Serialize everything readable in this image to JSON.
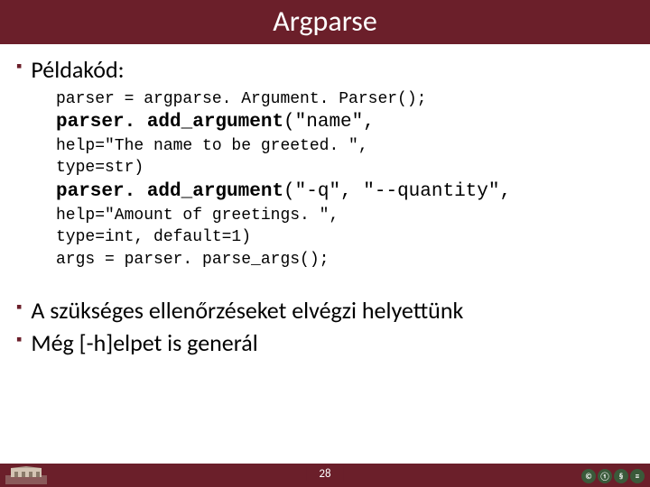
{
  "title": "Argparse",
  "bullets": {
    "example_label": "Példakód:",
    "summary1": "A szükséges ellenőrzéseket elvégzi helyettünk",
    "summary2": "Még [-h]elpet is generál"
  },
  "code": {
    "l1": "parser = argparse. Argument. Parser();",
    "l2a": "parser. add_argument",
    "l2b": "(\"name\",",
    "l3": "help=\"The name to be greeted. \",",
    "l4": "type=str)",
    "l5a": "parser. add_argument",
    "l5b": "(\"-q\", \"--quantity\",",
    "l6": "help=\"Amount of greetings. \",",
    "l7": "type=int, default=1)",
    "l8": "args = parser. parse_args();"
  },
  "page": "28",
  "badges": [
    "©",
    "①",
    "§",
    "≡"
  ]
}
